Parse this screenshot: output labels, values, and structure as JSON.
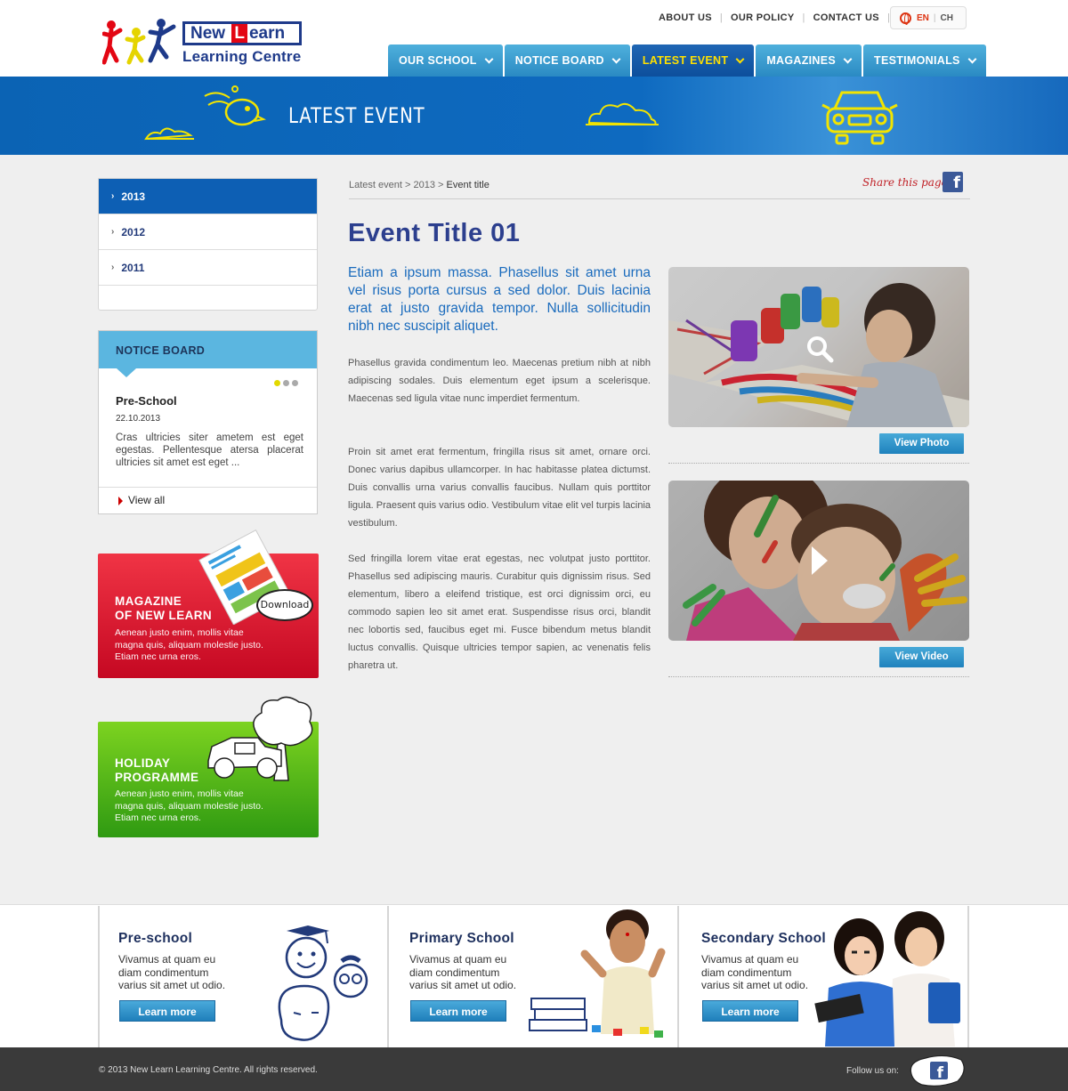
{
  "header": {
    "logo": {
      "line1_a": "New ",
      "line1_hl": "L",
      "line1_b": "earn",
      "line2": "Learning Centre"
    },
    "top_links": [
      "ABOUT US",
      "OUR POLICY",
      "CONTACT US"
    ],
    "lang": {
      "en": "EN",
      "ch": "CH"
    },
    "nav": [
      "OUR SCHOOL",
      "NOTICE BOARD",
      "LATEST EVENT",
      "MAGAZINES",
      "TESTIMONIALS"
    ],
    "active_nav": "LATEST EVENT"
  },
  "banner": {
    "title": "LATEST EVENT"
  },
  "sidebar": {
    "years": [
      "2013",
      "2012",
      "2011"
    ],
    "active_year": "2013",
    "notice": {
      "heading": "NOTICE BOARD",
      "title": "Pre-School",
      "date": "22.10.2013",
      "text": "Cras ultricies siter ametem est eget egestas. Pellentesque atersa placerat ultricies sit amet est eget ...",
      "view_all": "View all"
    },
    "magazine": {
      "title_1": "MAGAZINE",
      "title_2": "OF NEW LEARN",
      "text": "Aenean justo enim, mollis vitae magna quis, aliquam molestie justo. Etiam nec urna eros.",
      "bubble": "Download"
    },
    "holiday": {
      "title_1": "HOLIDAY",
      "title_2": "PROGRAMME",
      "text": "Aenean justo enim, mollis vitae magna quis, aliquam molestie justo. Etiam nec urna eros."
    }
  },
  "main": {
    "breadcrumb": {
      "a": "Latest event",
      "sep": " > ",
      "b": "2013",
      "c": "Event title"
    },
    "share_label": "Share this page:",
    "title": "Event Title 01",
    "lead": "Etiam a ipsum massa. Phasellus sit amet urna vel risus porta cursus a sed dolor. Duis lacinia erat at justo gravida tempor. Nulla sollicitudin nibh nec suscipit aliquet.",
    "paragraphs": [
      "Phasellus gravida condimentum leo. Maecenas pretium nibh at nibh adipiscing sodales. Duis elementum eget ipsum a scelerisque. Maecenas sed ligula vitae nunc imperdiet fermentum.",
      "Proin sit amet erat fermentum, fringilla risus sit amet, ornare orci. Donec varius dapibus ullamcorper. In hac habitasse platea dictumst. Duis convallis urna varius convallis faucibus. Nullam quis porttitor ligula. Praesent quis varius odio. Vestibulum vitae elit vel turpis lacinia vestibulum.",
      "Sed fringilla lorem vitae erat egestas, nec volutpat justo porttitor. Phasellus sed adipiscing mauris. Curabitur quis dignissim risus. Sed elementum, libero a eleifend tristique, est orci dignissim orci, eu commodo sapien leo sit amet erat. Suspendisse risus orci, blandit nec lobortis sed, faucibus eget mi. Fusce bibendum metus blandit luctus convallis. Quisque ultricies tempor sapien, ac venenatis felis pharetra ut."
    ],
    "view_photo": "View Photo",
    "view_video": "View Video"
  },
  "bottom": [
    {
      "title": "Pre-school",
      "text": "Vivamus at quam eu diam condimentum varius sit amet ut odio.",
      "button": "Learn more"
    },
    {
      "title": "Primary School",
      "text": "Vivamus at quam eu diam condimentum varius sit amet ut odio.",
      "button": "Learn more"
    },
    {
      "title": "Secondary School",
      "text": "Vivamus at quam eu diam condimentum varius sit amet ut odio.",
      "button": "Learn more"
    }
  ],
  "footer": {
    "copyright": "© 2013 New Learn Learning Centre. All rights reserved.",
    "follow": "Follow us on:"
  },
  "colors": {
    "brand_blue": "#0d5fb4",
    "nav_light": "#2a8ac3",
    "active_nav_text": "#ffe000",
    "title_blue": "#2c3f8e",
    "accent_red": "#c50822",
    "accent_green": "#2f9a12"
  }
}
